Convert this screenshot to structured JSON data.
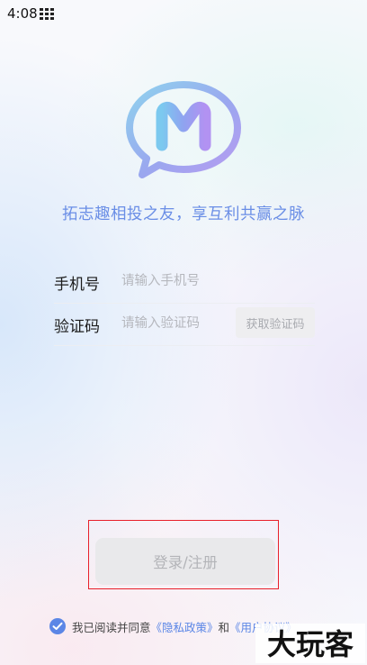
{
  "status_bar": {
    "time": "4:08",
    "grid_icon": "app-grid-icon"
  },
  "logo": {
    "icon": "chat-bubble-m-logo",
    "letter": "M"
  },
  "slogan": "拓志趣相投之友，享互利共赢之脉",
  "form": {
    "phone": {
      "label": "手机号",
      "placeholder": "请输入手机号",
      "value": ""
    },
    "code": {
      "label": "验证码",
      "placeholder": "请输入验证码",
      "value": "",
      "get_code_label": "获取验证码"
    }
  },
  "login_button": "登录/注册",
  "agreement": {
    "checked": true,
    "prefix": "我已阅读并同意",
    "privacy_link": "《隐私政策》",
    "and": "和",
    "user_link": "《用户协议》"
  },
  "watermark": "大玩客",
  "colors": {
    "accent": "#5b86e6",
    "slogan": "#6a8ee6",
    "highlight": "#e8202a",
    "button_bg": "#e9e9eb"
  }
}
